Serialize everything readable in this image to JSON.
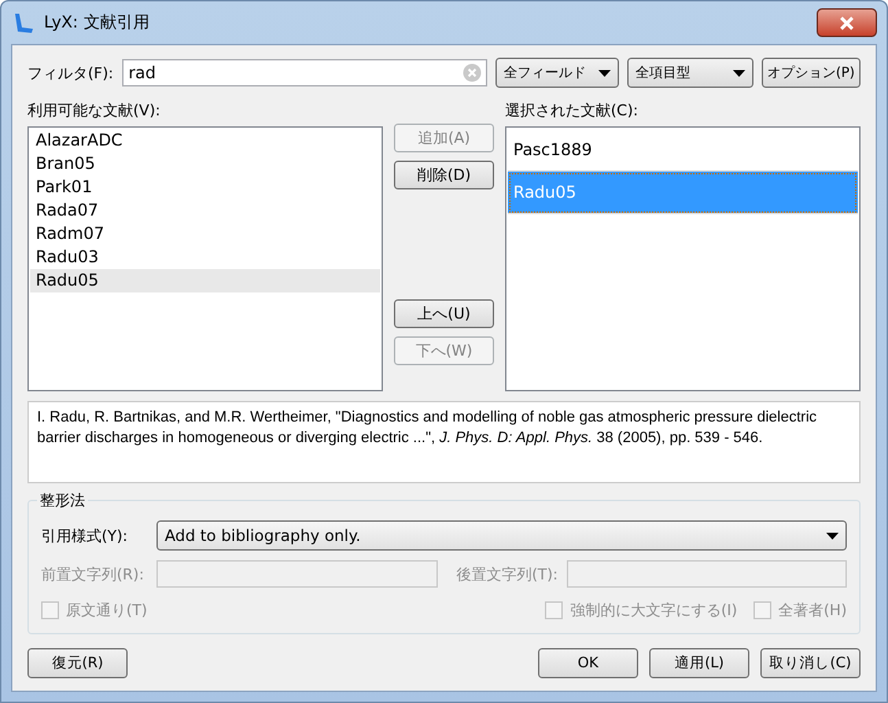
{
  "window": {
    "title": "LyX: 文献引用"
  },
  "filter": {
    "label": "フィルタ(F):",
    "value": "rad",
    "field_menu": "全フィールド",
    "type_menu": "全項目型",
    "options_button": "オプション(P)"
  },
  "available": {
    "label": "利用可能な文献(V):",
    "items": [
      {
        "text": "AlazarADC",
        "selected": false
      },
      {
        "text": "Bran05",
        "selected": false
      },
      {
        "text": "Park01",
        "selected": false
      },
      {
        "text": "Rada07",
        "selected": false
      },
      {
        "text": "Radm07",
        "selected": false
      },
      {
        "text": "Radu03",
        "selected": false
      },
      {
        "text": "Radu05",
        "selected": true
      }
    ]
  },
  "middle_buttons": {
    "upper": [
      {
        "label": "追加(A)",
        "disabled": true
      },
      {
        "label": "削除(D)",
        "disabled": false
      }
    ],
    "lower": [
      {
        "label": "上へ(U)",
        "disabled": false
      },
      {
        "label": "下へ(W)",
        "disabled": true
      }
    ]
  },
  "chosen": {
    "label": "選択された文献(C):",
    "items": [
      {
        "text": "Pasc1889",
        "selected": false
      },
      {
        "text": "Radu05",
        "selected": true
      }
    ]
  },
  "info": "I. Radu, R. Bartnikas, and M.R. Wertheimer, \"Diagnostics and modelling of noble gas atmospheric pressure dielectric barrier discharges in homogeneous or diverging electric ...\", *J. Phys. D: Appl. Phys.* 38 (2005), pp. 539 - 546.",
  "formatting": {
    "title": "整形法",
    "style_label": "引用様式(Y):",
    "style_value": "Add to bibliography only.",
    "before_label": "前置文字列(R):",
    "after_label": "後置文字列(T):",
    "fields_disabled": true,
    "checkboxes_left": [
      {
        "label": "原文通り(T)",
        "checked": false,
        "disabled": true
      }
    ],
    "checkboxes_right": [
      {
        "label": "強制的に大文字にする(I)",
        "checked": false,
        "disabled": true
      },
      {
        "label": "全著者(H)",
        "checked": false,
        "disabled": true
      }
    ]
  },
  "footer": {
    "restore": "復元(R)",
    "buttons": [
      "OK",
      "適用(L)",
      "取り消し(C)"
    ]
  }
}
